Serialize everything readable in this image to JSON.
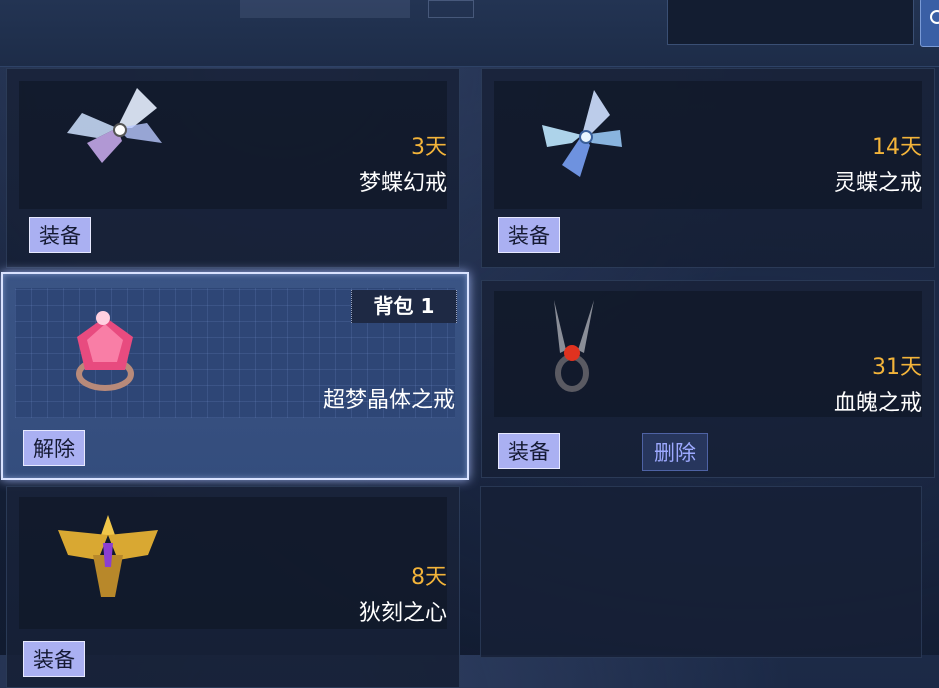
{
  "colors": {
    "days": "#f3b43a",
    "name": "#ffffff",
    "button_bg": "#aab0f2",
    "delete_text": "#9da9ff",
    "selected_border": "#d9e2ff"
  },
  "items": [
    {
      "name": "梦蝶幻戒",
      "days": "3天",
      "button": "装备",
      "icon": "butterfly-ring-icon"
    },
    {
      "name": "灵蝶之戒",
      "days": "14天",
      "button": "装备",
      "icon": "butterfly-ring-icon"
    },
    {
      "name": "超梦晶体之戒",
      "days": "",
      "button": "解除",
      "badge": "背包 1",
      "icon": "crystal-ring-icon"
    },
    {
      "name": "血魄之戒",
      "days": "31天",
      "button": "装备",
      "delete": "删除",
      "icon": "blood-ring-icon"
    },
    {
      "name": "狄刻之心",
      "days": "8天",
      "button": "装备",
      "icon": "golden-wing-ring-icon"
    }
  ]
}
